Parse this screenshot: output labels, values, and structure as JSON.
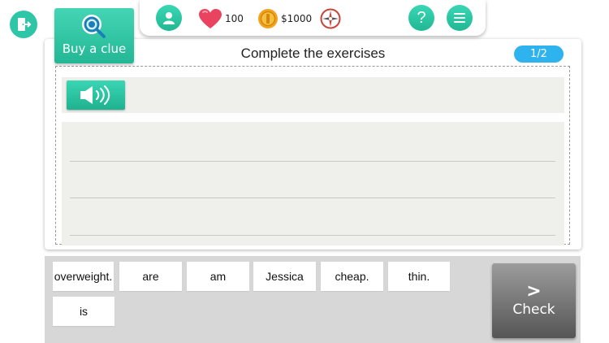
{
  "header": {
    "clue_label": "Buy a clue",
    "lives": "100",
    "money": "$1000",
    "help_label": "?"
  },
  "exercise": {
    "title": "Complete the exercises",
    "page": "1/2"
  },
  "word_bank": [
    "overweight.",
    "are",
    "am",
    "Jessica",
    "cheap.",
    "thin.",
    "is"
  ],
  "actions": {
    "check_label": "Check",
    "check_arrow": ">"
  },
  "colors": {
    "accent": "#2ec6a6",
    "pill": "#2eb3ee",
    "heart": "#e9435f",
    "coin": "#f2a21b",
    "check": "#6e6e6e"
  },
  "icons": [
    "exit-icon",
    "magnifier-icon",
    "user-icon",
    "heart-icon",
    "coin-icon",
    "compass-icon",
    "help-icon",
    "menu-icon",
    "speaker-icon",
    "chevron-right-icon"
  ]
}
